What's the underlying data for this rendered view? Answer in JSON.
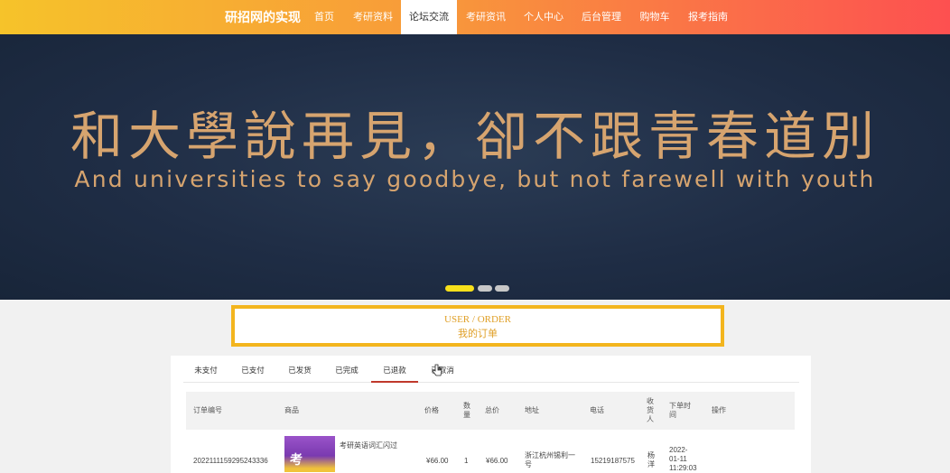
{
  "nav": {
    "brand": "研招网的实现",
    "items": [
      {
        "label": "首页"
      },
      {
        "label": "考研资料"
      },
      {
        "label": "论坛交流"
      },
      {
        "label": "考研资讯"
      },
      {
        "label": "个人中心"
      },
      {
        "label": "后台管理"
      },
      {
        "label": "购物车"
      },
      {
        "label": "报考指南"
      }
    ],
    "active_index": 2
  },
  "banner": {
    "title_cn": "和大學說再見，卻不跟青春道別",
    "title_en": "And universities to say goodbye, but not farewell with youth",
    "slide_count": 3,
    "active_slide": 0
  },
  "order_header": {
    "en": "USER / ORDER",
    "cn": "我的订单"
  },
  "tabs": [
    {
      "label": "未支付"
    },
    {
      "label": "已支付"
    },
    {
      "label": "已发货"
    },
    {
      "label": "已完成"
    },
    {
      "label": "已退款"
    },
    {
      "label": "已取消"
    }
  ],
  "active_tab": 4,
  "table": {
    "headers": [
      "订单编号",
      "商品",
      "价格",
      "数量",
      "总价",
      "地址",
      "电话",
      "收货人",
      "下单时间",
      "操作"
    ],
    "rows": [
      {
        "order_no": "20221111592952433​36",
        "product": "考研英语词汇闪过",
        "price": "¥66.00",
        "qty": "1",
        "total": "¥66.00",
        "address": "浙江杭州锡利一号",
        "phone": "15219187575",
        "receiver": "杨洋",
        "time": "2022-01-11 11:29:03"
      }
    ]
  },
  "colors": {
    "nav_gradient_start": "#f6c32a",
    "nav_gradient_end": "#fd5050",
    "banner_bg": "#1f2d45",
    "banner_text": "#d6a46f",
    "accent_yellow": "#f3b51e",
    "active_tab_border": "#c0392b"
  }
}
